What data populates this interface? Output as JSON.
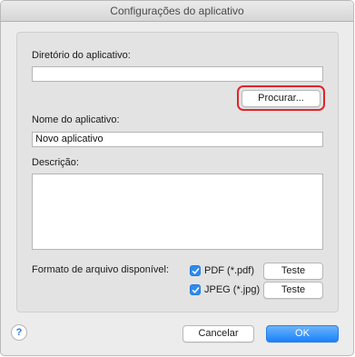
{
  "window": {
    "title": "Configurações do aplicativo"
  },
  "form": {
    "dir_label": "Diretório do aplicativo:",
    "dir_value": "",
    "browse_label": "Procurar...",
    "name_label": "Nome do aplicativo:",
    "name_value": "Novo aplicativo",
    "desc_label": "Descrição:",
    "desc_value": "",
    "format_label": "Formato de arquivo disponível:",
    "formats": [
      {
        "label": "PDF (*.pdf)",
        "checked": true,
        "test_label": "Teste"
      },
      {
        "label": "JPEG (*.jpg)",
        "checked": true,
        "test_label": "Teste"
      }
    ]
  },
  "footer": {
    "help_glyph": "?",
    "cancel_label": "Cancelar",
    "ok_label": "OK"
  },
  "icons": {
    "help": "question-mark-icon",
    "check": "checkmark-icon"
  },
  "colors": {
    "accent": "#1a82fb",
    "highlight": "#e0252b",
    "checkbox": "#2d8cf0"
  }
}
